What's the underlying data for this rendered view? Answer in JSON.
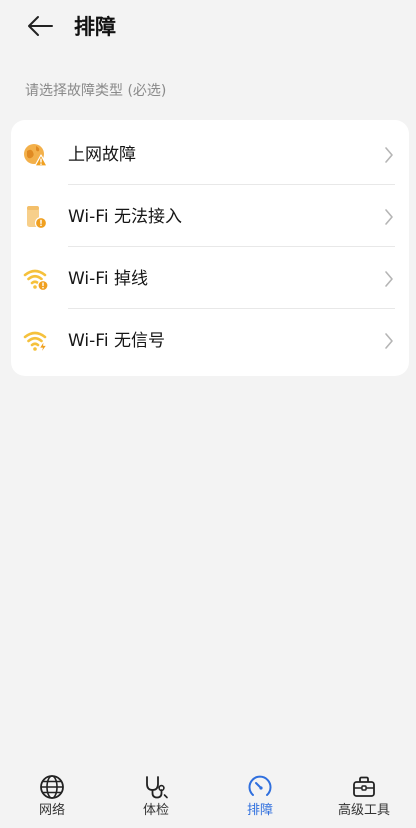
{
  "header": {
    "title": "排障",
    "back_icon": "arrow-left-icon"
  },
  "section": {
    "label": "请选择故障类型 (必选)"
  },
  "fault_types": [
    {
      "label": "上网故障",
      "icon": "globe-warning-icon"
    },
    {
      "label": "Wi-Fi 无法接入",
      "icon": "router-warning-icon"
    },
    {
      "label": "Wi-Fi 掉线",
      "icon": "wifi-warning-icon"
    },
    {
      "label": "Wi-Fi 无信号",
      "icon": "wifi-lightning-icon"
    }
  ],
  "bottom_nav": [
    {
      "label": "网络",
      "icon": "globe-icon",
      "active": false
    },
    {
      "label": "体检",
      "icon": "stethoscope-icon",
      "active": false
    },
    {
      "label": "排障",
      "icon": "speedometer-icon",
      "active": true
    },
    {
      "label": "高级工具",
      "icon": "toolbox-icon",
      "active": false
    }
  ],
  "colors": {
    "accent": "#2f6fde",
    "warning": "#f0a020",
    "wifi_yellow": "#f5c13c",
    "background": "#f3f3f3"
  }
}
